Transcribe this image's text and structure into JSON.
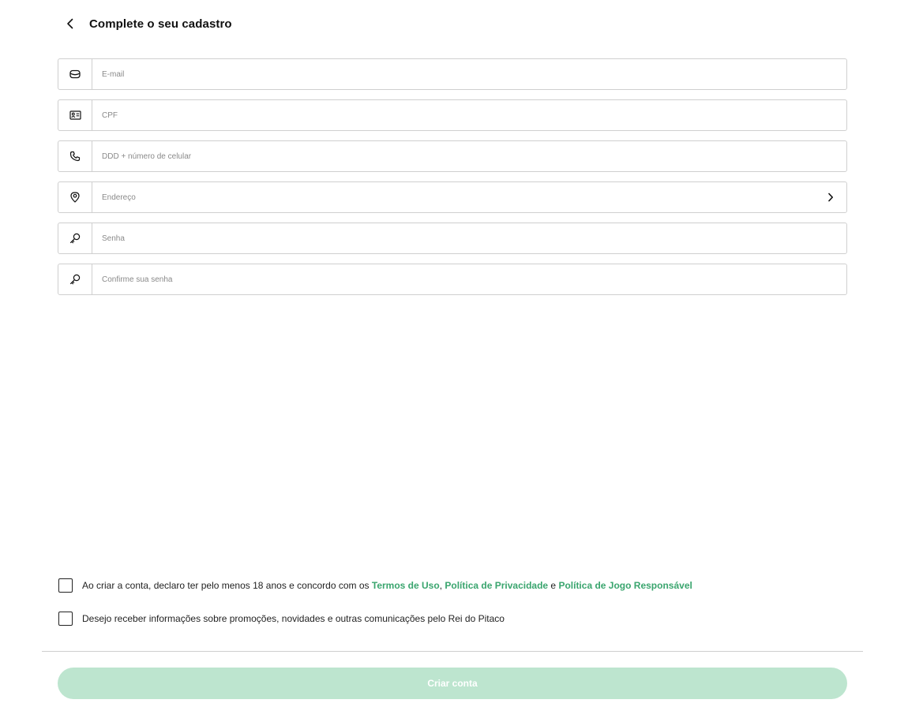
{
  "header": {
    "back_icon": "chevron-left-icon",
    "title": "Complete o seu cadastro"
  },
  "fields": {
    "email": {
      "icon": "mail-icon",
      "placeholder": "E-mail",
      "value": ""
    },
    "cpf": {
      "icon": "id-card-icon",
      "placeholder": "CPF",
      "value": ""
    },
    "phone": {
      "icon": "phone-icon",
      "placeholder": "DDD + número de celular",
      "value": ""
    },
    "address": {
      "icon": "map-pin-icon",
      "placeholder": "Endereço",
      "value": "",
      "trailing_icon": "chevron-right-icon"
    },
    "password": {
      "icon": "key-icon",
      "placeholder": "Senha",
      "value": ""
    },
    "confirm_password": {
      "icon": "key-icon",
      "placeholder": "Confirme sua senha",
      "value": ""
    }
  },
  "consent": {
    "terms": {
      "checked": false,
      "text_before": "Ao criar a conta, declaro ter pelo menos 18 anos e concordo com os ",
      "link_terms": "Termos de Uso",
      "sep1": ", ",
      "link_privacy": "Política de Privacidade",
      "sep2": " e ",
      "link_responsible": "Política de Jogo Responsável"
    },
    "marketing": {
      "checked": false,
      "text": "Desejo receber informações sobre promoções, novidades e outras comunicações pelo Rei do Pitaco"
    }
  },
  "submit": {
    "label": "Criar conta",
    "enabled": false
  },
  "colors": {
    "accent_link": "#3aa56e",
    "button_disabled_bg": "#bde5cf",
    "border": "#cfcfcf"
  }
}
